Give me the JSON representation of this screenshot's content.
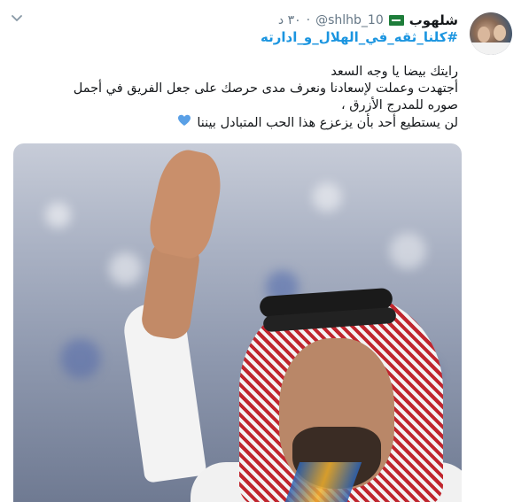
{
  "tweet": {
    "author_name": "شلهوب",
    "handle": "@shlhb_10",
    "separator": "·",
    "time": "٣٠ د",
    "hashtag": "#كلنا_ثقه_في_الهلال_و_ادارته",
    "body_lines": [
      "رايتك بيضا يا وجه السعد",
      "أجتهدت وعملت لإسعادنا ونعرف مدى حرصك على جعل الفريق في أجمل صوره للمدرج الأزرق ،",
      "لن يستطيع أحد بأن يزعزع هذا الحب المتبادل بيننا"
    ],
    "heart_color": "#5aa0e6",
    "icons": {
      "menu": "chevron-down-icon",
      "flag": "saudi-flag-icon",
      "heart": "blue-heart-icon"
    },
    "colors": {
      "link": "#1b95e0",
      "muted": "#657786",
      "text": "#14171a"
    }
  }
}
